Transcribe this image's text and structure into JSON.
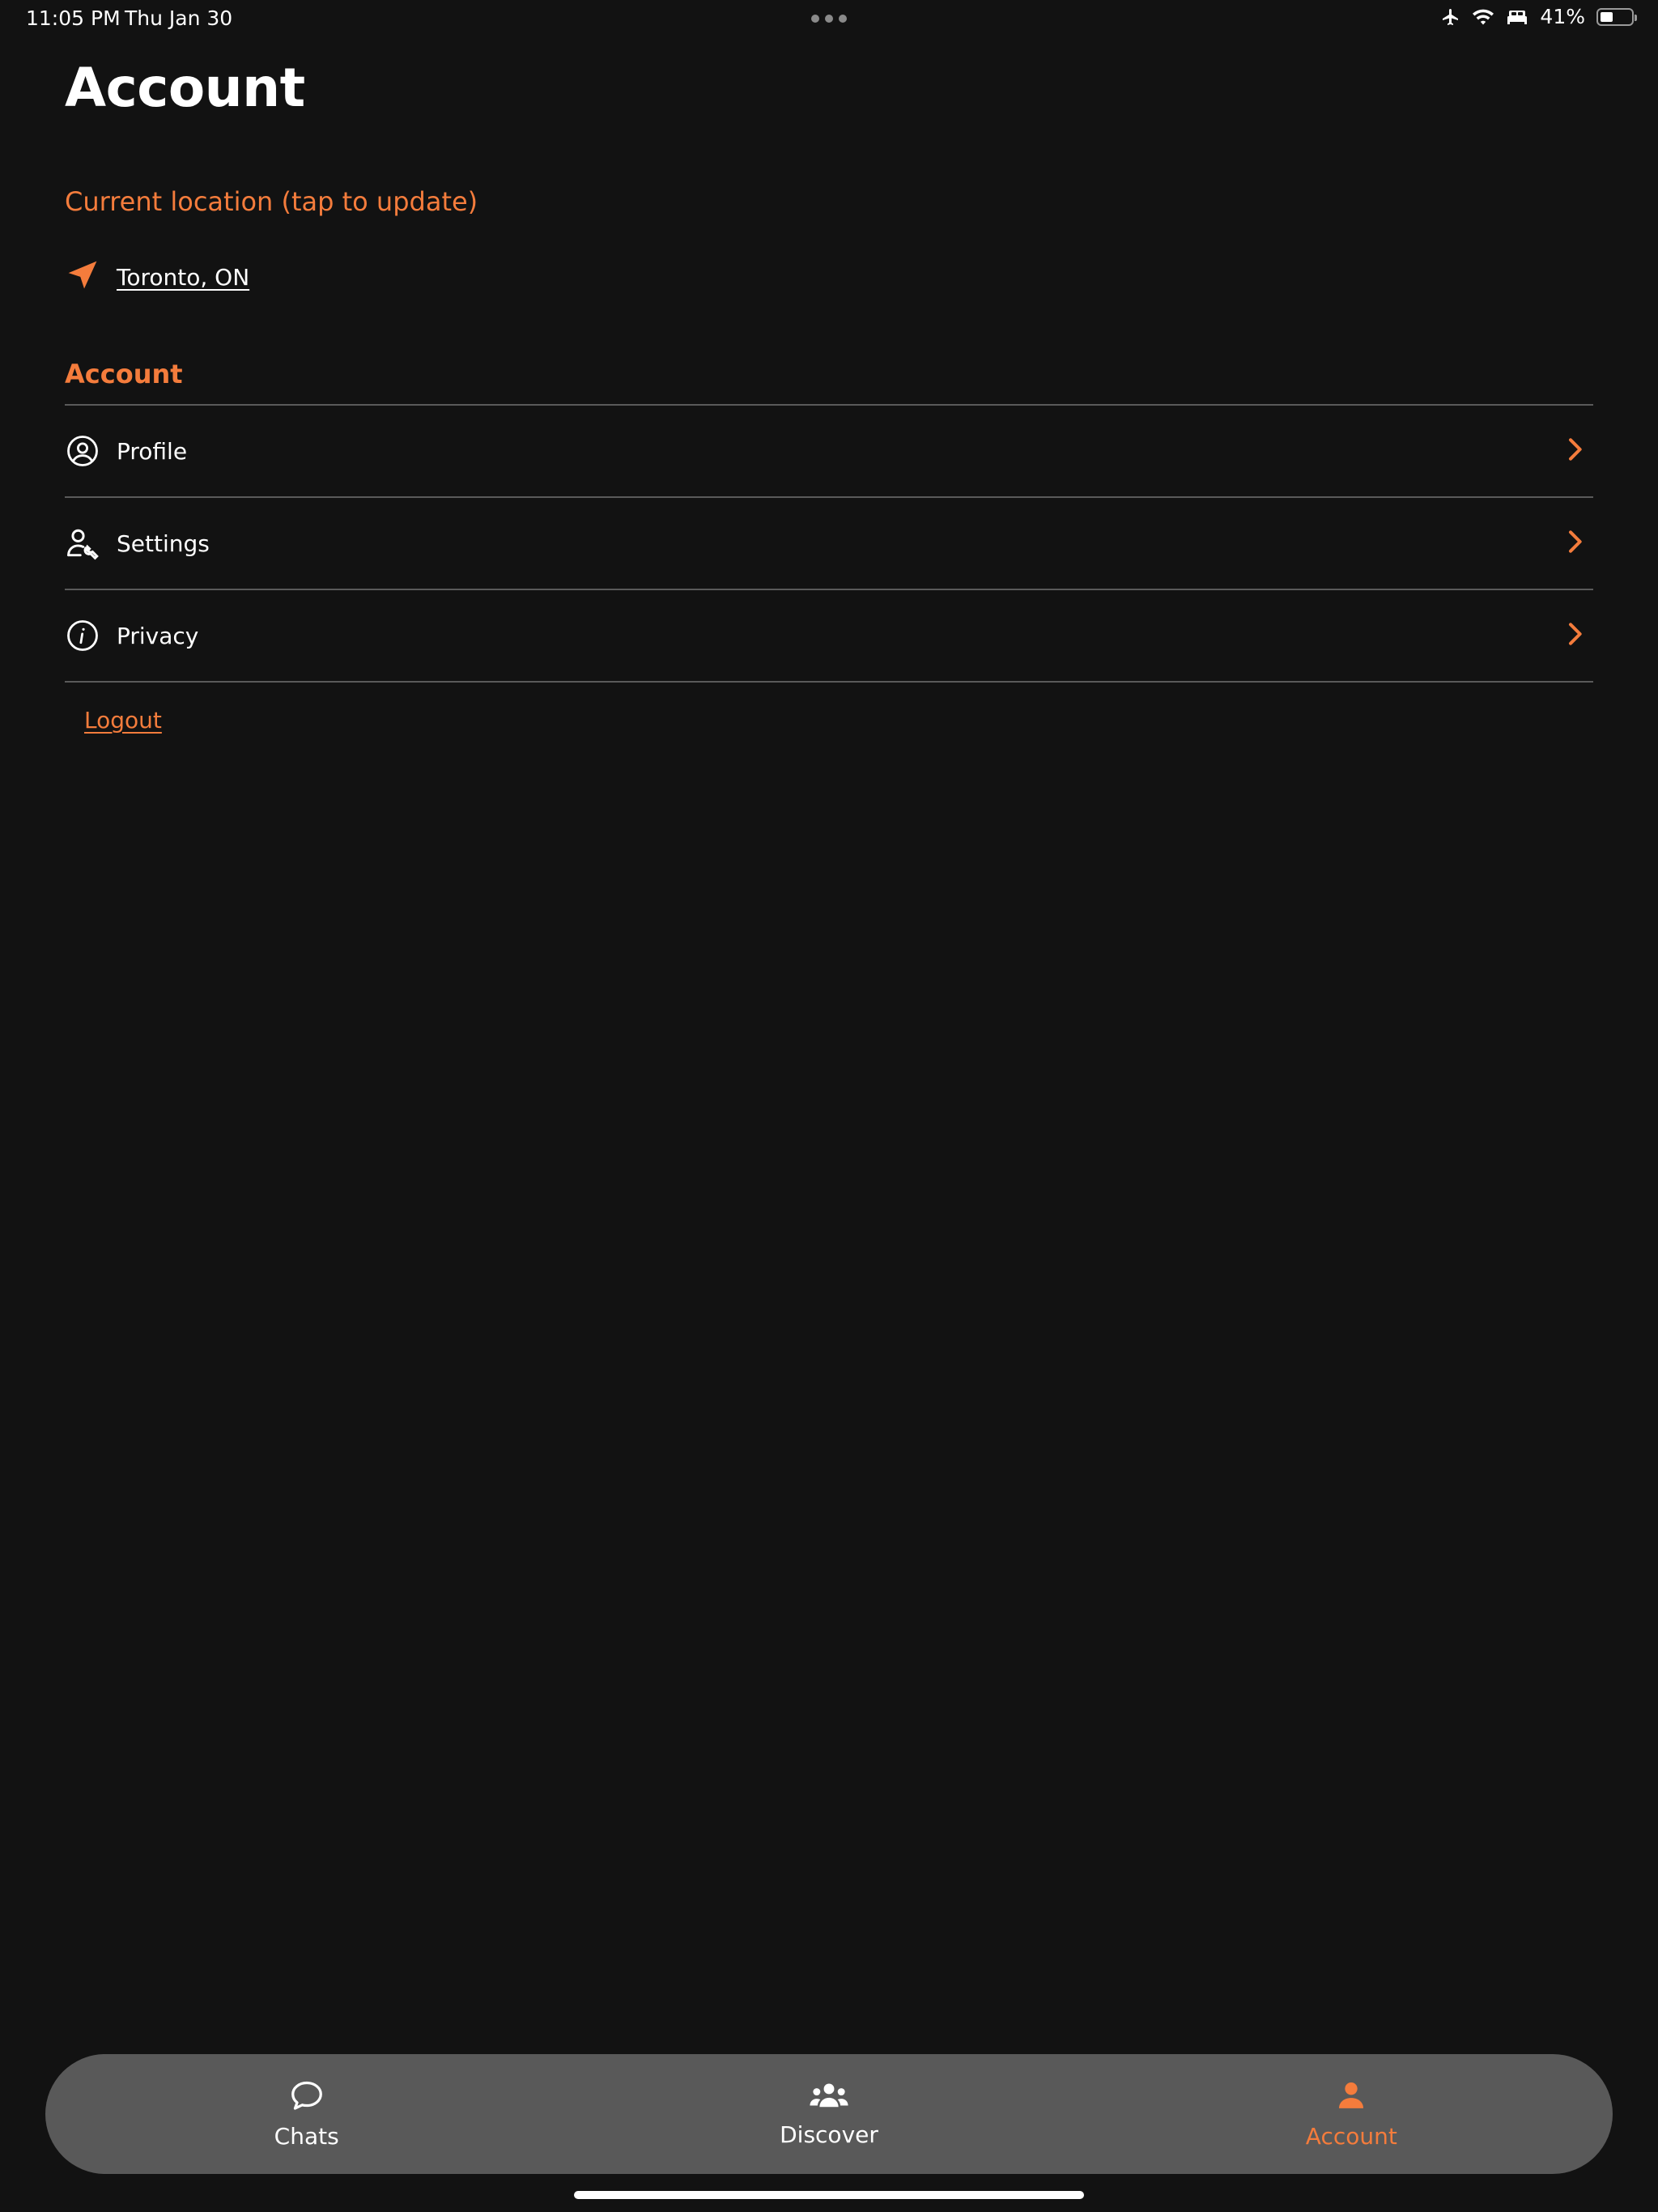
{
  "status_bar": {
    "time": "11:05 PM",
    "date": "Thu Jan 30",
    "battery_percent": "41%",
    "battery_level": 0.41,
    "icons": [
      "airplane-icon",
      "wifi-icon",
      "bed-icon",
      "battery-icon"
    ]
  },
  "page": {
    "title": "Account"
  },
  "location": {
    "label": "Current location (tap to update)",
    "value": "Toronto, ON",
    "icon": "navigation-arrow-icon"
  },
  "account_section": {
    "header": "Account",
    "items": [
      {
        "label": "Profile",
        "icon": "user-circle-icon"
      },
      {
        "label": "Settings",
        "icon": "user-wrench-icon"
      },
      {
        "label": "Privacy",
        "icon": "info-circle-icon"
      }
    ],
    "logout_label": "Logout"
  },
  "tab_bar": {
    "tabs": [
      {
        "label": "Chats",
        "icon": "chat-bubble-icon",
        "active": false
      },
      {
        "label": "Discover",
        "icon": "group-icon",
        "active": false
      },
      {
        "label": "Account",
        "icon": "person-icon",
        "active": true
      }
    ]
  },
  "colors": {
    "background": "#121212",
    "accent": "#f47c3c",
    "text": "#ffffff",
    "divider": "#5a5a5a",
    "tab_bar": "#595959"
  }
}
